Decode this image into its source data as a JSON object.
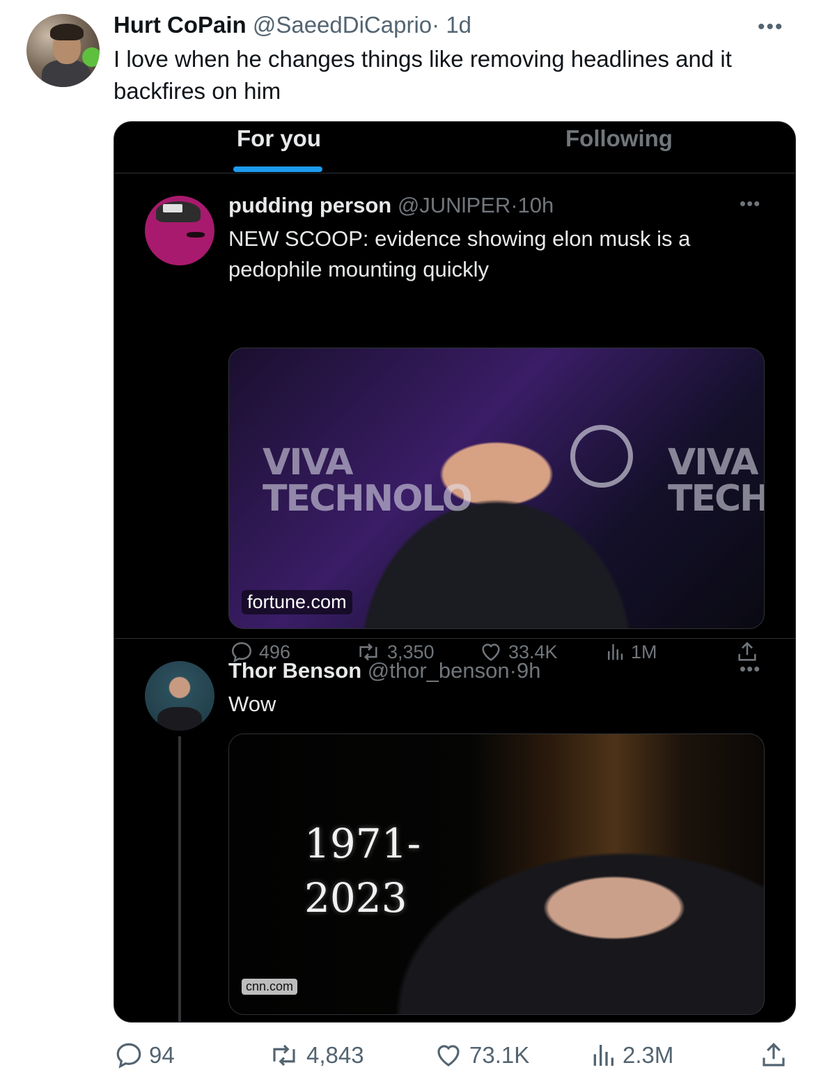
{
  "outer_tweet": {
    "name": "Hurt CoPain",
    "handle": "@SaeedDiCaprio",
    "separator": "·",
    "time": "1d",
    "more": "•••",
    "text": "I love when he changes things like removing headlines and it backfires on him",
    "stats": {
      "replies": "94",
      "reposts": "4,843",
      "likes": "73.1K",
      "views": "2.3M"
    }
  },
  "embedded": {
    "tabs": [
      {
        "label": "For you",
        "active": true
      },
      {
        "label": "Following",
        "active": false
      }
    ],
    "tweets": [
      {
        "name": "pudding person",
        "handle": "@JUNlPER",
        "separator": "·",
        "time": "10h",
        "more": "•••",
        "text": "NEW SCOOP:  evidence showing elon musk is a pedophile mounting quickly",
        "media_source": "fortune.com",
        "stats": {
          "replies": "496",
          "reposts": "3,350",
          "likes": "33.4K",
          "views": "1M"
        }
      },
      {
        "name": "Thor Benson",
        "handle": "@thor_benson",
        "separator": "·",
        "time": "9h",
        "more": "•••",
        "text": "Wow",
        "media_source": "cnn.com",
        "media_years": "1971-\n2023"
      }
    ]
  },
  "colors": {
    "accent": "#1d9bf0",
    "dark_bg": "#000000",
    "dark_text": "#e7e9ea",
    "dark_muted": "#71767b",
    "light_text": "#0f1419",
    "light_muted": "#536471"
  }
}
